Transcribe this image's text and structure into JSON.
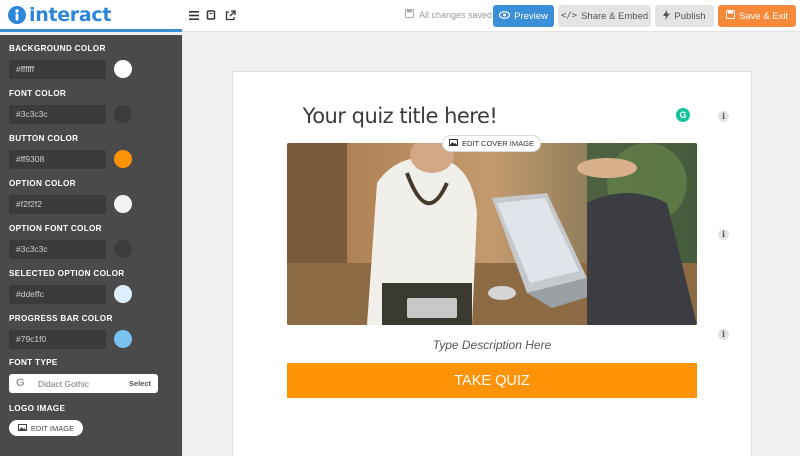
{
  "app": {
    "brand_name": "interact"
  },
  "toolbar": {
    "icons": [
      "menu-icon",
      "book-icon",
      "external-link-icon"
    ],
    "saved_status": "All changes saved",
    "preview_label": "Preview",
    "share_label": "Share & Embed",
    "publish_label": "Publish",
    "save_exit_label": "Save & Exit"
  },
  "sidebar": {
    "colors": [
      {
        "label": "BACKGROUND COLOR",
        "value": "#ffffff",
        "swatch": "#ffffff"
      },
      {
        "label": "FONT COLOR",
        "value": "#3c3c3c",
        "swatch": "#3c3c3c"
      },
      {
        "label": "BUTTON COLOR",
        "value": "#ff9308",
        "swatch": "#ff9308"
      },
      {
        "label": "OPTION COLOR",
        "value": "#f2f2f2",
        "swatch": "#f2f2f2"
      },
      {
        "label": "OPTION FONT COLOR",
        "value": "#3c3c3c",
        "swatch": "#3c3c3c"
      },
      {
        "label": "SELECTED OPTION COLOR",
        "value": "#ddeffc",
        "swatch": "#ddeffc"
      },
      {
        "label": "PROGRESS BAR COLOR",
        "value": "#79c1f0",
        "swatch": "#79c1f0"
      }
    ],
    "font_type_label": "FONT TYPE",
    "font_type_value": "Didact Gothic",
    "font_select_label": "Select",
    "logo_label": "LOGO IMAGE",
    "edit_image_label": "EDIT IMAGE"
  },
  "quiz": {
    "title": "Your quiz title here!",
    "edit_cover_label": "EDIT COVER IMAGE",
    "description": "Type Description Here",
    "take_quiz_label": "TAKE QUIZ"
  },
  "accent_colors": {
    "primary": "#3b8fd9",
    "save": "#f6893a",
    "button": "#ff9308",
    "sidebar": "#4a4a4a"
  }
}
